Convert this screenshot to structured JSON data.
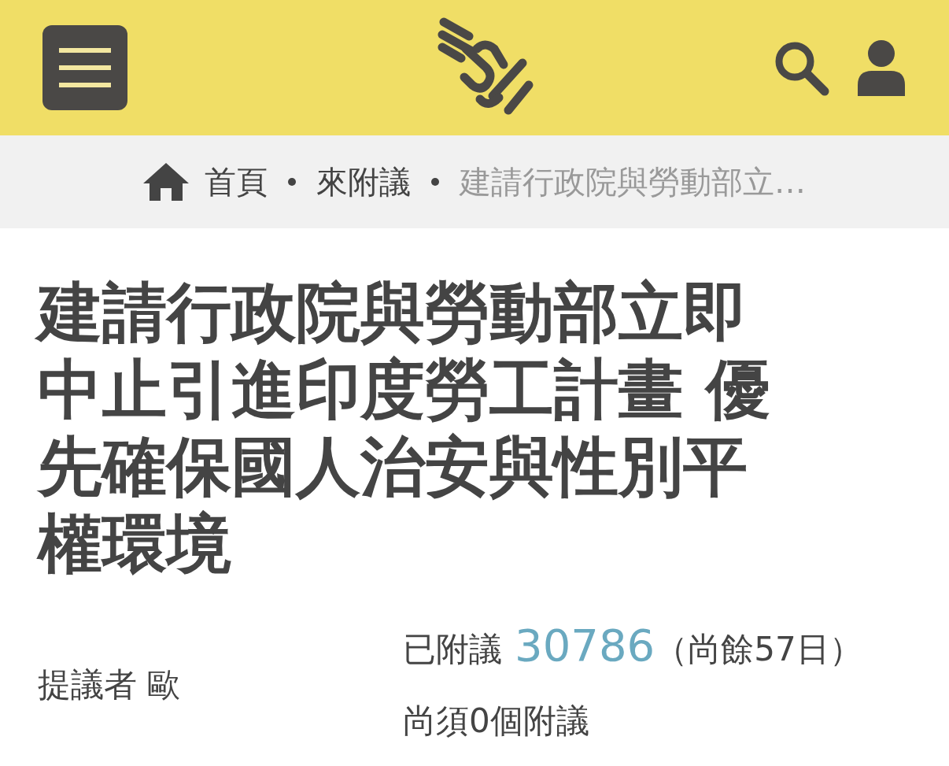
{
  "breadcrumb": [
    {
      "label": "首頁",
      "kind": "link"
    },
    {
      "label": "來附議",
      "kind": "link"
    },
    {
      "label": "建請行政院與勞動部立…",
      "kind": "current"
    }
  ],
  "title": "建請行政院與勞動部立即中止引進印度勞工計畫 優先確保國人治安與性別平權環境",
  "proposer": {
    "label": "提議者",
    "name": "歐"
  },
  "signatures": {
    "label": "已附議",
    "count": "30786",
    "remaining": "（尚餘57日）",
    "needed": "尚須0個附議"
  }
}
